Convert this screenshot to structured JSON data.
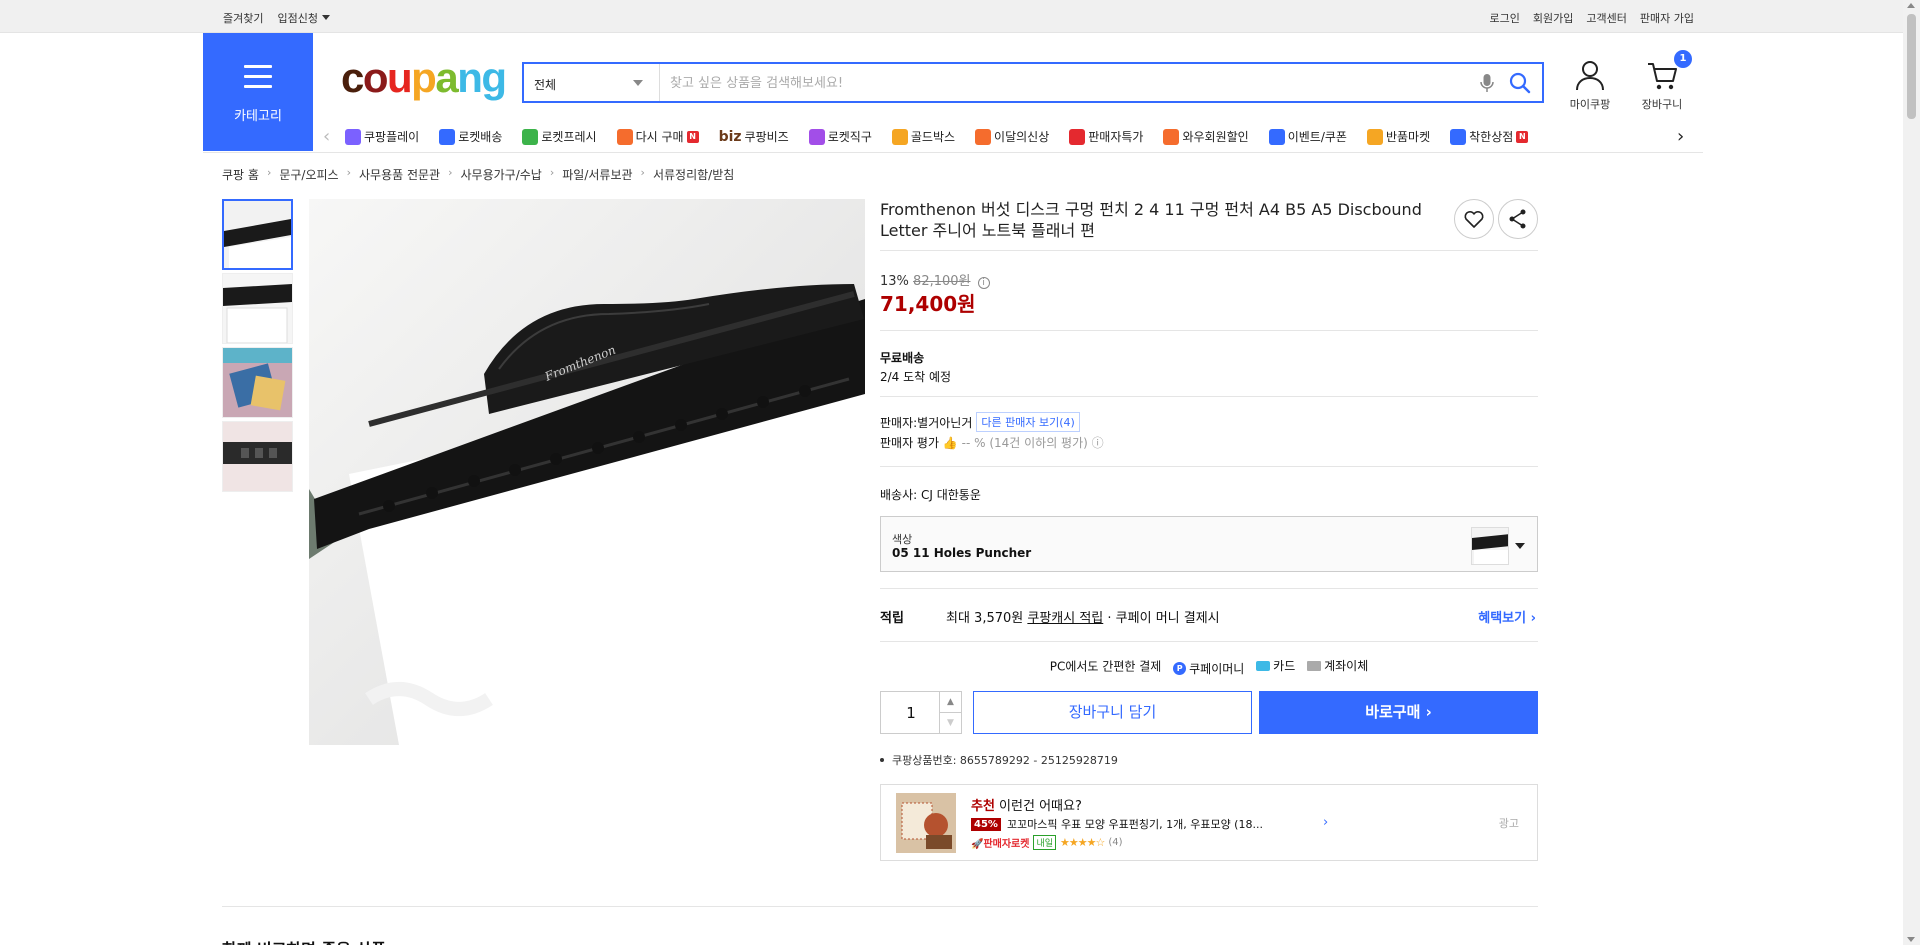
{
  "topbar": {
    "left": [
      "즐겨찾기",
      "입점신청"
    ],
    "right": [
      "로그인",
      "회원가입",
      "고객센터",
      "판매자 가입"
    ]
  },
  "header": {
    "category_label": "카테고리",
    "logo": [
      "c",
      "o",
      "u",
      "p",
      "a",
      "ng"
    ],
    "search": {
      "category": "전체",
      "placeholder": "찾고 싶은 상품을 검색해보세요!"
    },
    "mycoupang_label": "마이쿠팡",
    "cart_label": "장바구니",
    "cart_count": "1"
  },
  "nav": {
    "items": [
      {
        "label": "쿠팡플레이",
        "icon": "play-icon",
        "color": "#7b61ff"
      },
      {
        "label": "로켓배송",
        "icon": "rocket-icon",
        "color": "#346aff"
      },
      {
        "label": "로켓프레시",
        "icon": "rocket-fresh-icon",
        "color": "#3cb34a"
      },
      {
        "label": "다시 구매",
        "icon": "rebuy-icon",
        "color": "#f56c2d",
        "badge": "N"
      },
      {
        "label": "쿠팡비즈",
        "icon": "biz-icon",
        "prefix": "biz",
        "color": "#6b3a1a"
      },
      {
        "label": "로켓직구",
        "icon": "rocket-global-icon",
        "color": "#a24ee8"
      },
      {
        "label": "골드박스",
        "icon": "gold-box-icon",
        "color": "#f5a623"
      },
      {
        "label": "이달의신상",
        "icon": "new-icon",
        "color": "#f56c2d"
      },
      {
        "label": "판매자특가",
        "icon": "percent-icon",
        "color": "#e4292f"
      },
      {
        "label": "와우회원할인",
        "icon": "wow-icon",
        "color": "#f56c2d"
      },
      {
        "label": "이벤트/쿠폰",
        "icon": "coupon-icon",
        "color": "#346aff"
      },
      {
        "label": "반품마켓",
        "icon": "return-market-icon",
        "color": "#f5a623"
      },
      {
        "label": "착한상점",
        "icon": "good-store-icon",
        "color": "#346aff",
        "badge": "N"
      }
    ]
  },
  "breadcrumb": [
    "쿠팡 홈",
    "문구/오피스",
    "사무용품 전문관",
    "사무용가구/수납",
    "파일/서류보관",
    "서류정리함/받침"
  ],
  "product": {
    "title": "Fromthenon 버섯 디스크 구멍 펀치 2 4 11 구멍 펀처 A4 B5 A5 Discbound Letter 주니어 노트북 플래너 편",
    "brand_on_image": "Fromthenon",
    "discount_rate": "13%",
    "original_price": "82,100원",
    "price": "71,400원",
    "shipping_title": "무료배송",
    "shipping_eta": "2/4 도착 예정",
    "seller_label": "판매자:",
    "seller_name": "별거아닌거",
    "other_sellers": "다른 판매자 보기(4)",
    "seller_rating_label": "판매자 평가",
    "seller_rating_value": "-- % (14건 이하의 평가)",
    "carrier": "배송사:  CJ 대한통운",
    "option_key": "색상",
    "option_value": "05 11 Holes Puncher",
    "reward_label": "적립",
    "reward_prefix": "최대 3,570원",
    "reward_link": "쿠팡캐시 적립",
    "reward_suffix": "· 쿠페이 머니 결제시",
    "benefit_link": "혜택보기",
    "pay_title": "PC에서도 간편한 결제",
    "pay_methods": [
      "쿠페이머니",
      "카드",
      "계좌이체"
    ],
    "quantity": "1",
    "add_to_cart": "장바구니 담기",
    "buy_now": "바로구매",
    "product_id": "쿠팡상품번호: 8655789292 - 25125928719"
  },
  "recommend": {
    "title_highlight": "추천",
    "title_rest": " 이런건 어때요?",
    "discount": "45%",
    "name": "꼬꼬마스픽 우표 모양 우표펀칭기, 1개, 우표모양 (18...",
    "rocket": "판매자로켓",
    "delivery": "내일",
    "rating": 4.5,
    "review_count": "(4)",
    "ad_label": "광고"
  },
  "bottom_section_title": "함께 비교하면 좋을 상품"
}
